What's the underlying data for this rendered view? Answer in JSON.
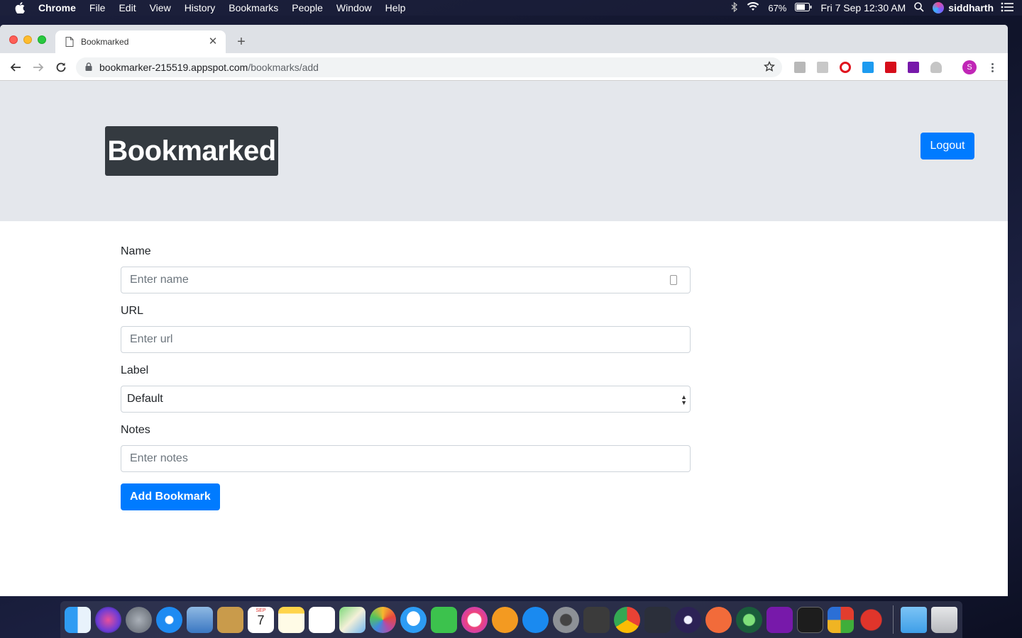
{
  "menubar": {
    "app_name": "Chrome",
    "items": [
      "File",
      "Edit",
      "View",
      "History",
      "Bookmarks",
      "People",
      "Window",
      "Help"
    ],
    "battery": "67%",
    "datetime": "Fri 7 Sep  12:30 AM",
    "user": "siddharth"
  },
  "browser": {
    "tab_title": "Bookmarked",
    "url_host": "bookmarker-215519.appspot.com",
    "url_path": "/bookmarks/add",
    "profile_initial": "S"
  },
  "header": {
    "brand": "Bookmarked",
    "logout_label": "Logout"
  },
  "form": {
    "name_label": "Name",
    "name_placeholder": "Enter name",
    "url_label": "URL",
    "url_placeholder": "Enter url",
    "label_label": "Label",
    "label_selected": "Default",
    "notes_label": "Notes",
    "notes_placeholder": "Enter notes",
    "submit_label": "Add Bookmark"
  },
  "colors": {
    "primary": "#007bff",
    "brand_bg": "#343a40",
    "jumbotron_bg": "#e4e7ec"
  },
  "dock": {
    "apps": [
      "finder-icon",
      "siri-icon",
      "launchpad-icon",
      "safari-icon",
      "mail-icon",
      "notes-book-icon",
      "calendar-icon",
      "notes-icon",
      "reminders-icon",
      "maps-icon",
      "photos-icon",
      "messages-icon",
      "facetime-icon",
      "itunes-icon",
      "books-icon",
      "app-store-icon",
      "system-preferences-icon",
      "sublime-text-icon",
      "chrome-icon",
      "vscode-icon",
      "eclipse-icon",
      "postman-icon",
      "gitkraken-icon",
      "onenote-icon",
      "terminal-icon",
      "windows-icon",
      "boxing-glove-icon",
      "folder-icon",
      "trash-icon"
    ],
    "calendar_month": "SEP",
    "calendar_day": "7"
  }
}
